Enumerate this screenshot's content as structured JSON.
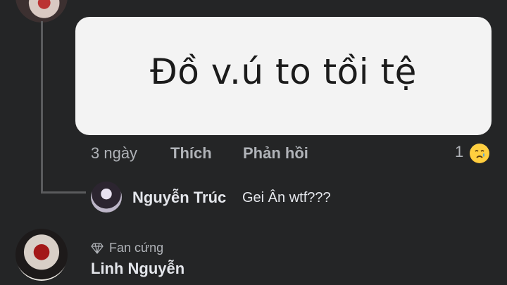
{
  "comment": {
    "image_text": "Đồ v.ú to tồi tệ",
    "time": "3 ngày",
    "like_label": "Thích",
    "reply_label": "Phản hồi",
    "reaction_count": "1",
    "reaction_icon": "crying-face-icon"
  },
  "reply": {
    "author": "Nguyễn Trúc",
    "text": "Gei Ân wtf???"
  },
  "next_comment": {
    "badge_icon": "diamond-icon",
    "badge_label": "Fan cứng",
    "author": "Linh Nguyễn"
  },
  "colors": {
    "background": "#242526",
    "bubble": "#f3f3f3",
    "muted_text": "#b0b3b8",
    "primary_text": "#e4e6eb",
    "thread_line": "#5a5b5d"
  }
}
